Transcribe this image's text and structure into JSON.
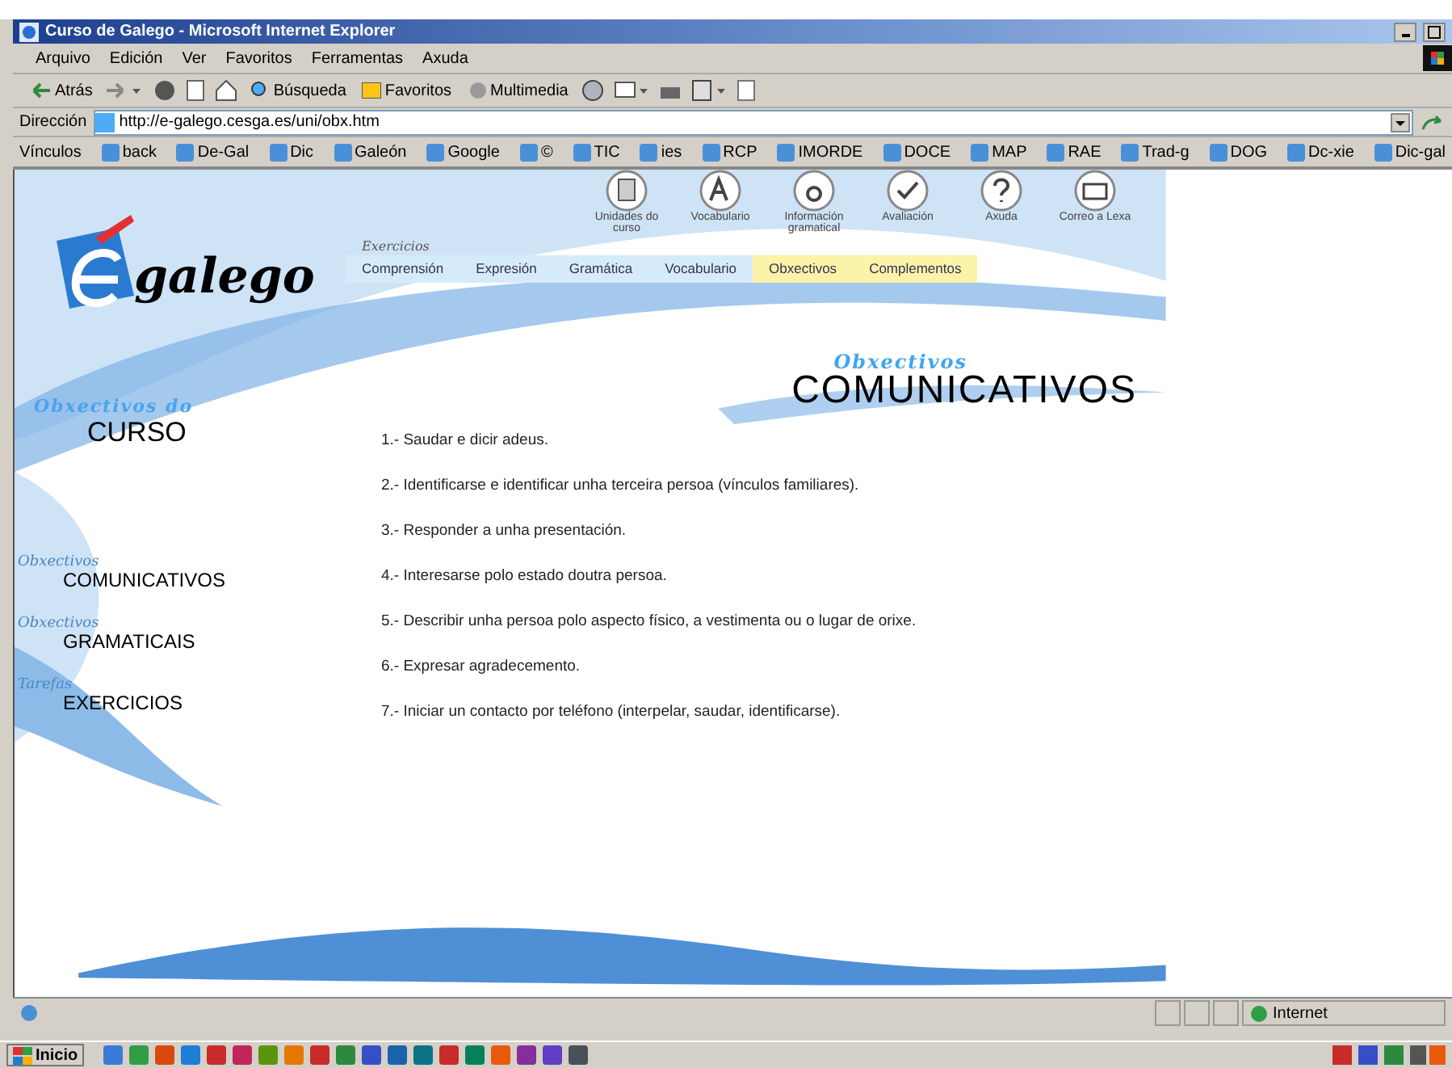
{
  "window": {
    "title": "Curso de Galego - Microsoft Internet Explorer"
  },
  "menu": [
    "Arquivo",
    "Edición",
    "Ver",
    "Favoritos",
    "Ferramentas",
    "Axuda"
  ],
  "toolbar": {
    "back": "Atrás",
    "search": "Búsqueda",
    "favorites": "Favoritos",
    "media": "Multimedia"
  },
  "address": {
    "label": "Dirección",
    "value": "http://e-galego.cesga.es/uni/obx.htm"
  },
  "links": {
    "label": "Vínculos",
    "items": [
      "back",
      "De-Gal",
      "Dic",
      "Galeón",
      "Google",
      "©",
      "TIC",
      "ies",
      "RCP",
      "IMORDE",
      "DOCE",
      "MAP",
      "RAE",
      "Trad-g",
      "DOG",
      "Dc-xie",
      "Dic-gal"
    ]
  },
  "logo": {
    "text": "galego"
  },
  "header_icons": [
    {
      "kind": "book",
      "label": "Unidades do curso"
    },
    {
      "kind": "letter",
      "label": "Vocabulario"
    },
    {
      "kind": "accent",
      "label": "Información gramatical"
    },
    {
      "kind": "check",
      "label": "Avaliación"
    },
    {
      "kind": "help",
      "label": "Axuda"
    },
    {
      "kind": "mail",
      "label": "Correo a Lexa"
    }
  ],
  "tabs": {
    "label": "Exercicios",
    "items": [
      {
        "label": "Comprensión",
        "kind": "exercise"
      },
      {
        "label": "Expresión",
        "kind": "exercise"
      },
      {
        "label": "Gramática",
        "kind": "exercise"
      },
      {
        "label": "Vocabulario",
        "kind": "exercise"
      },
      {
        "label": "Obxectivos",
        "kind": "extra"
      },
      {
        "label": "Complementos",
        "kind": "extra"
      }
    ]
  },
  "sidebar": {
    "kicker": "Obxectivos do",
    "title": "CURSO",
    "items": [
      {
        "tag": "Obxectivos",
        "label": "COMUNICATIVOS"
      },
      {
        "tag": "Obxectivos",
        "label": "GRAMATICAIS"
      },
      {
        "tag": "Tarefas",
        "label": "EXERCICIOS"
      }
    ]
  },
  "heading": {
    "kicker": "Obxectivos",
    "title": "COMUNICATIVOS"
  },
  "objectives": [
    "1.- Saudar e dicir adeus.",
    "2.- Identificarse e identificar unha terceira persoa (vínculos familiares).",
    "3.- Responder a unha presentación.",
    "4.- Interesarse polo estado doutra persoa.",
    "5.- Describir unha persoa polo aspecto físico, a vestimenta ou o lugar de orixe.",
    "6.- Expresar agradecemento.",
    "7.- Iniciar un contacto por teléfono (interpelar, saudar, identificarse)."
  ],
  "status_bar": {
    "zone": "Internet"
  },
  "taskbar": {
    "start": "Inicio"
  }
}
